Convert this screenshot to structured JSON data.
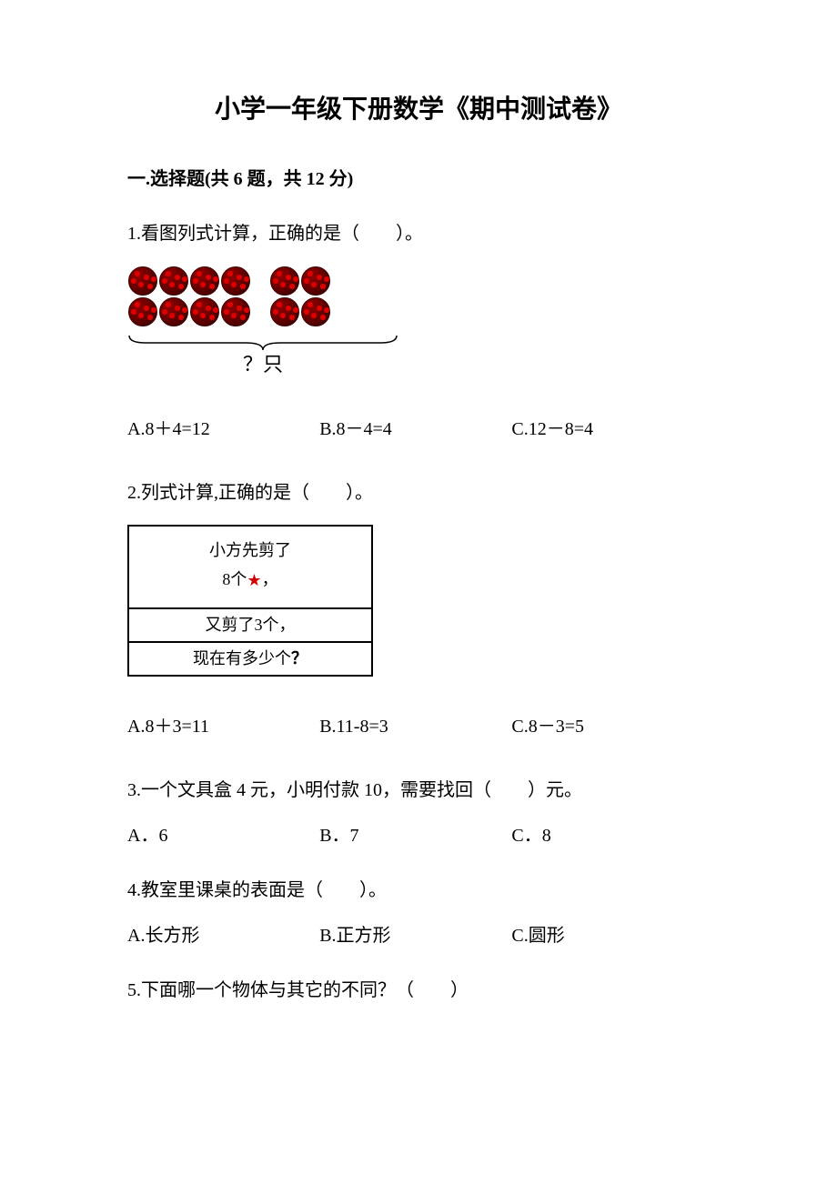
{
  "title": "小学一年级下册数学《期中测试卷》",
  "section1": {
    "header": "一.选择题(共 6 题，共 12 分)"
  },
  "q1": {
    "text": "1.看图列式计算，正确的是（　　）。",
    "qmark": "？只",
    "optA_prefix": "A.",
    "optA": "8＋4=12",
    "optB_prefix": "B.",
    "optB": "8－4=4",
    "optC_prefix": "C.",
    "optC": "12－8=4"
  },
  "q2": {
    "text": "2.列式计算,正确的是（　　）。",
    "box_top_line1": "小方先剪了",
    "box_top_line2_a": "8个",
    "box_top_line2_b": "，",
    "box_mid": "又剪了3个，",
    "box_bot_a": "现在有多少个",
    "box_bot_b": "？",
    "optA_prefix": "A.",
    "optA": "8＋3=11",
    "optB_prefix": "B.",
    "optB": "11-8=3",
    "optC_prefix": "C.",
    "optC": "8－3=5"
  },
  "q3": {
    "text": "3.一个文具盒 4 元，小明付款 10，需要找回（　　）元。",
    "optA_prefix": "A．",
    "optA": "6",
    "optB_prefix": "B．",
    "optB": "7",
    "optC_prefix": "C．",
    "optC": "8"
  },
  "q4": {
    "text": "4.教室里课桌的表面是（　　）。",
    "optA_prefix": "A.",
    "optA": "长方形",
    "optB_prefix": "B.",
    "optB": "正方形",
    "optC_prefix": "C.",
    "optC": "圆形"
  },
  "q5": {
    "text": "5.下面哪一个物体与其它的不同？（　　）"
  }
}
